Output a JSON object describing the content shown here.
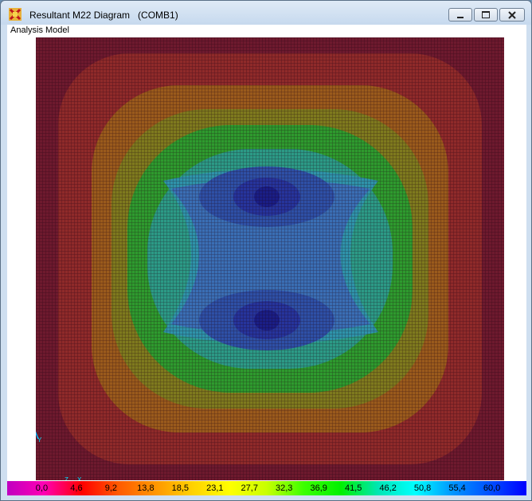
{
  "window": {
    "title": "Resultant M22 Diagram   (COMB1)",
    "icon": "sap-app-icon",
    "buttons": {
      "minimize": "minimize-icon",
      "maximize": "maximize-icon",
      "close": "close-icon"
    }
  },
  "view": {
    "label": "Analysis Model"
  },
  "axes": {
    "y_label": "Y",
    "x_label": "X",
    "z_label": "Z"
  },
  "legend": {
    "values": [
      "0,0",
      "4,6",
      "9,2",
      "13,8",
      "18,5",
      "23,1",
      "27,7",
      "32,3",
      "36,9",
      "41,5",
      "46,2",
      "50,8",
      "55,4",
      "60,0"
    ],
    "colors": [
      "#c000c0",
      "#ff00b4",
      "#ff0000",
      "#ff5a00",
      "#ff9600",
      "#ffd200",
      "#ffff00",
      "#c8ff00",
      "#3cff00",
      "#00f000",
      "#00e6b4",
      "#00ffff",
      "#0096ff",
      "#0050ff",
      "#0000ff"
    ]
  },
  "contour": {
    "colors": {
      "outer": "#6e1a2e",
      "red": "#8f2a2a",
      "orange": "#9a5a1c",
      "yellow": "#7e7a1e",
      "green": "#2e9a2e",
      "teal": "#2c9a86",
      "cyan": "#2f93aa",
      "blue_light": "#3a6eb4",
      "blue": "#2e50a6",
      "blue_dark": "#26349c",
      "navy": "#1a1e86",
      "grid": "#1a0010"
    }
  }
}
